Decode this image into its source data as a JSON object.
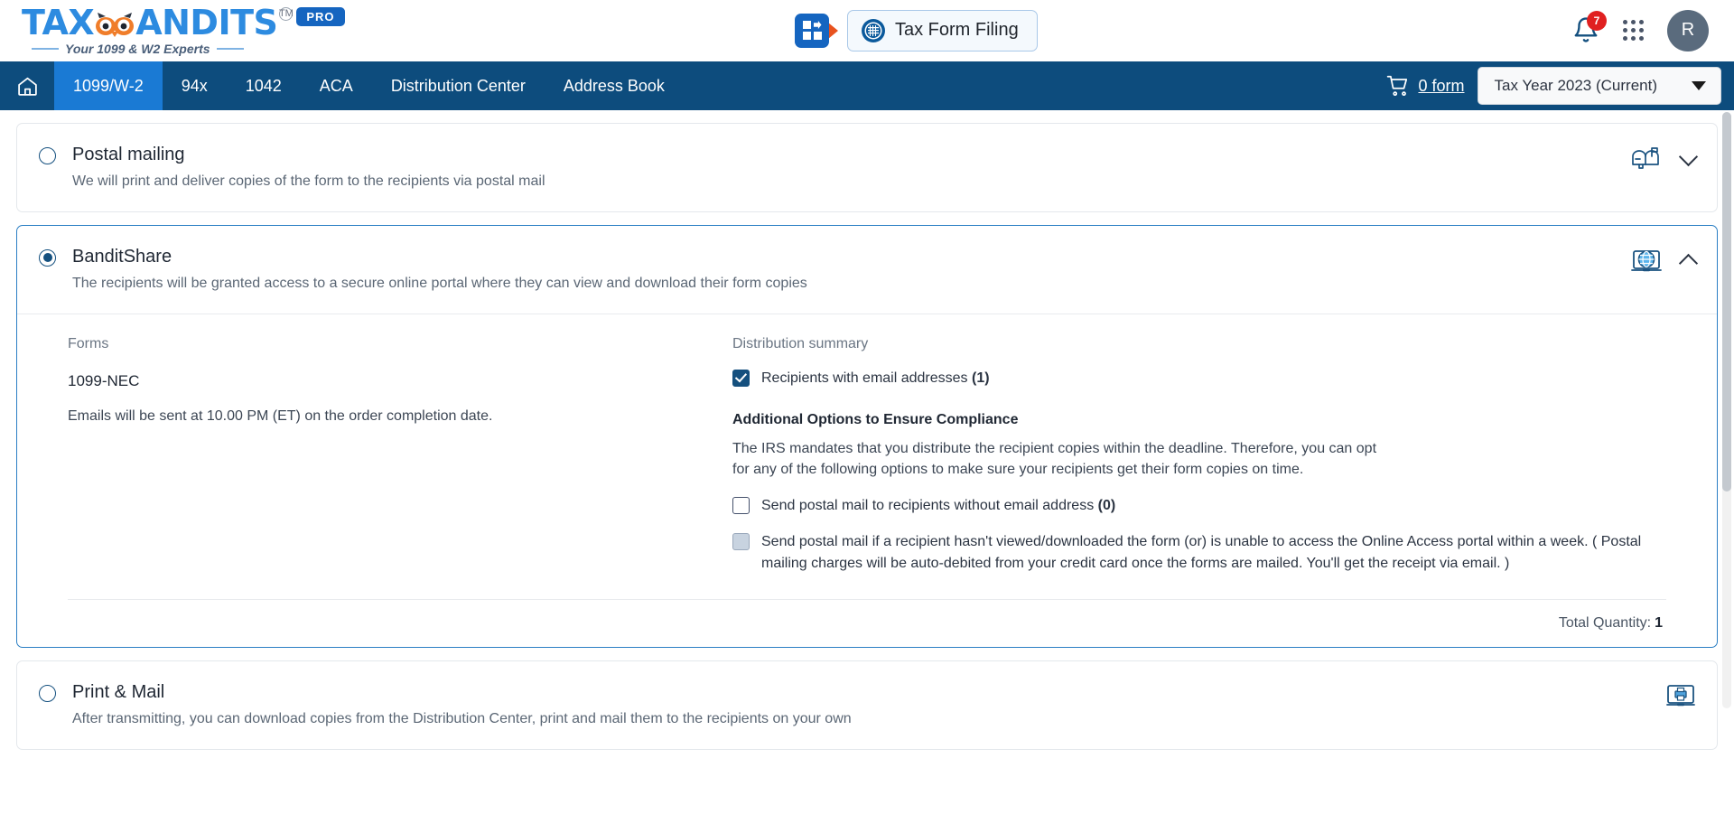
{
  "header": {
    "logo": {
      "text_primary": "TAX",
      "text_secondary": "ANDITS",
      "tm": "TM",
      "pro_badge": "PRO",
      "tagline": "Your 1099 & W2 Experts"
    },
    "app_switcher_icon": "grid-arrow-icon",
    "tax_form_filing_label": "Tax Form Filing",
    "tax_form_filing_icon": "irs-seal-icon",
    "notification_icon": "bell-icon",
    "notification_count": "7",
    "apps_icon": "apps-grid-icon",
    "avatar_initial": "R"
  },
  "nav": {
    "home_icon": "home-icon",
    "items": [
      {
        "label": "1099/W-2",
        "active": true
      },
      {
        "label": "94x",
        "active": false
      },
      {
        "label": "1042",
        "active": false
      },
      {
        "label": "ACA",
        "active": false
      },
      {
        "label": "Distribution Center",
        "active": false
      },
      {
        "label": "Address Book",
        "active": false
      }
    ],
    "cart_icon": "cart-icon",
    "cart_label": "0 form",
    "tax_year_label": "Tax Year 2023 (Current)",
    "tax_year_caret": "chevron-down-icon"
  },
  "options": {
    "postal": {
      "title": "Postal mailing",
      "subtitle": "We will print and deliver copies of the form to the recipients via postal mail",
      "selected": false,
      "icon": "mailbox-icon",
      "chevron": "chevron-down-icon"
    },
    "banditshare": {
      "title": "BanditShare",
      "subtitle": "The recipients will be granted access to a secure online portal where they can view and download their form copies",
      "selected": true,
      "icon": "globe-laptop-icon",
      "chevron": "chevron-up-icon",
      "forms_heading": "Forms",
      "form_name": "1099-NEC",
      "email_note": "Emails will be sent at 10.00 PM (ET) on the order completion date.",
      "distribution_heading": "Distribution summary",
      "recipients_email_label": "Recipients with email addresses ",
      "recipients_email_count": "(1)",
      "recipients_email_checked": true,
      "additional_heading": "Additional Options to Ensure Compliance",
      "additional_para": "The IRS mandates that you distribute the recipient copies within the deadline. Therefore, you can opt for any of the following options to make sure your recipients get their form copies on time.",
      "opt1_label": "Send postal mail to recipients without email address ",
      "opt1_count": "(0)",
      "opt1_checked": false,
      "opt2_label": "Send postal mail if a recipient hasn't viewed/downloaded the form (or) is unable to access the Online Access portal within a week. ( Postal mailing charges will be auto-debited from your credit card once the forms are mailed. You'll get the receipt via email. )",
      "opt2_checked": false,
      "opt2_disabled": true,
      "total_quantity_label": "Total Quantity:",
      "total_quantity_value": "1"
    },
    "printmail": {
      "title": "Print & Mail",
      "subtitle": "After transmitting, you can download copies from the Distribution Center, print and mail them to the recipients on your own",
      "selected": false,
      "icon": "printer-monitor-icon"
    }
  },
  "colors": {
    "nav_bar": "#0d4c7d",
    "nav_active": "#1a7ad4",
    "accent_blue": "#1565c0",
    "accent_orange": "#e8521e",
    "badge_red": "#e02020",
    "selected_border": "#2b7fc4",
    "checkbox_checked": "#15507e"
  }
}
